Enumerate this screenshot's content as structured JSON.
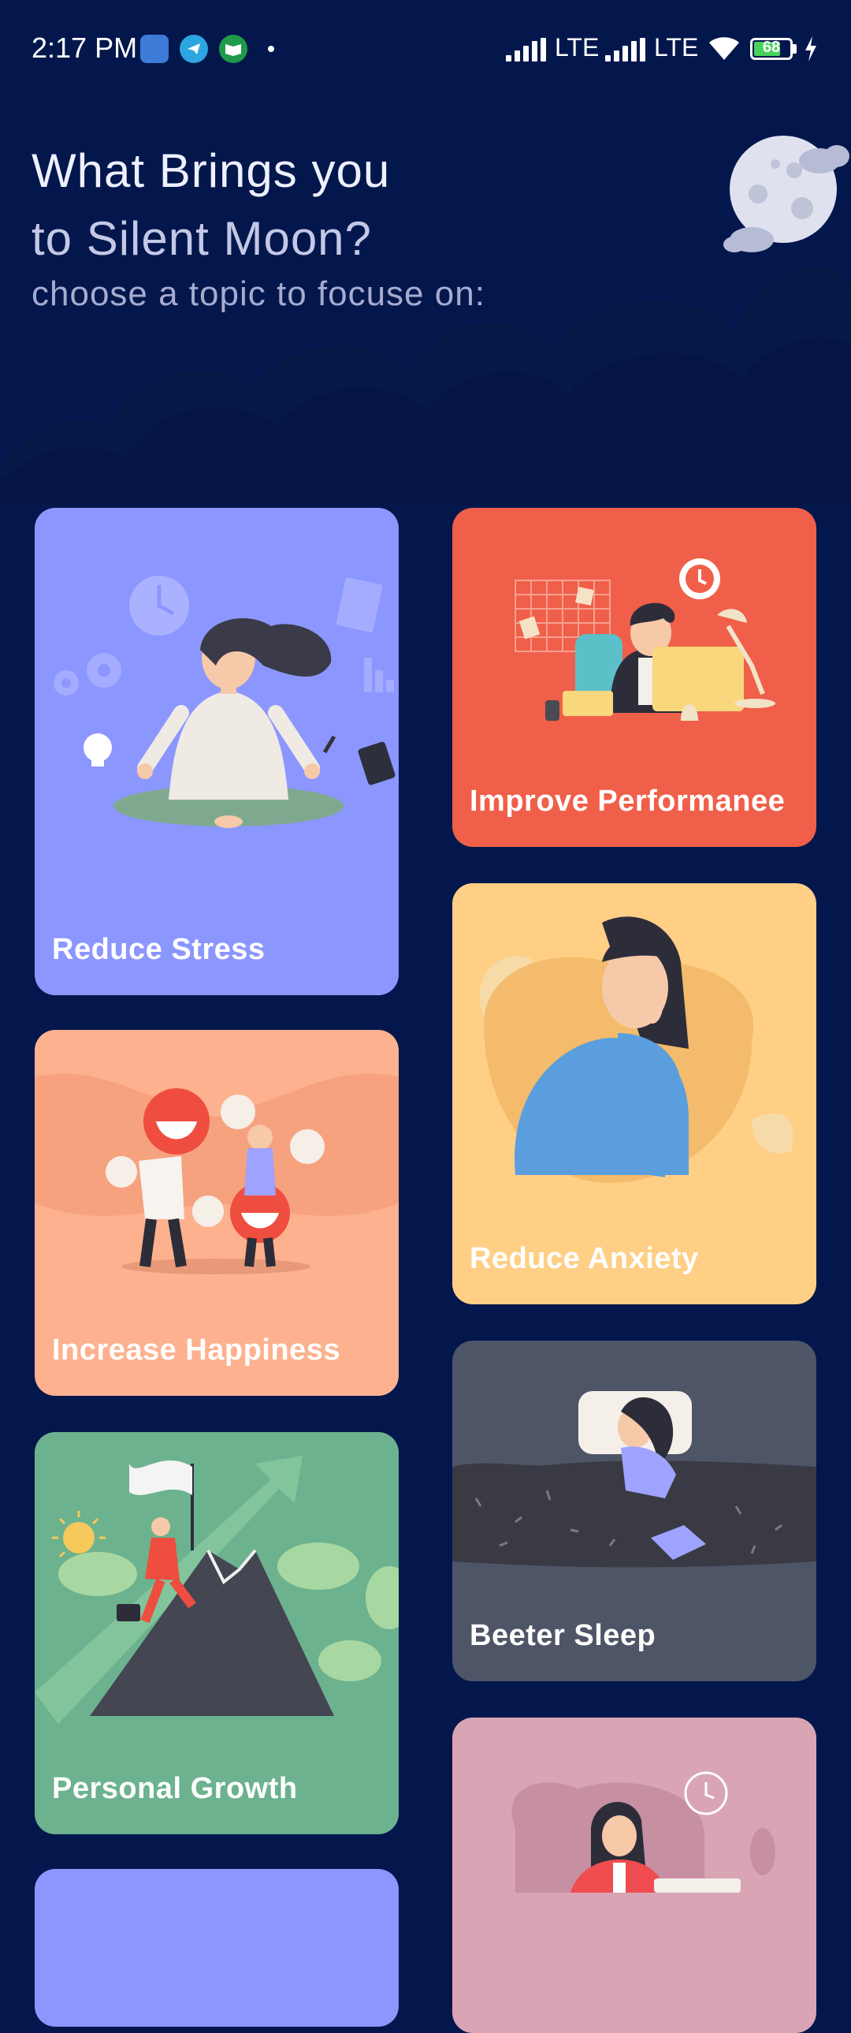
{
  "status_bar": {
    "time": "2:17 PM",
    "network_1": "LTE",
    "network_2": "LTE",
    "battery": "68",
    "icons": [
      "usb-debug-icon",
      "telegram-icon",
      "book-app-icon",
      "signal-icon",
      "wifi-icon",
      "battery-icon",
      "charging-icon"
    ]
  },
  "header": {
    "title_line1": "What Brings you",
    "title_line2": "to Silent Moon?",
    "subtitle": "choose a topic to focuse on:"
  },
  "topics": [
    {
      "label": "Reduce Stress",
      "color": "#8c96ff"
    },
    {
      "label": "Improve Performanee",
      "color": "#f05f49"
    },
    {
      "label": "Increase Happiness",
      "color": "#feb18f"
    },
    {
      "label": "Reduce Anxiety",
      "color": "#ffcf86"
    },
    {
      "label": "Personal Growth",
      "color": "#6cb28e"
    },
    {
      "label": "Beeter Sleep",
      "color": "#4e5567"
    },
    {
      "label": "",
      "color": "#8c96ff"
    },
    {
      "label": "",
      "color": "#d9a5b5"
    }
  ],
  "colors": {
    "background": "#03174c",
    "cloud": "#0a1a4f"
  }
}
